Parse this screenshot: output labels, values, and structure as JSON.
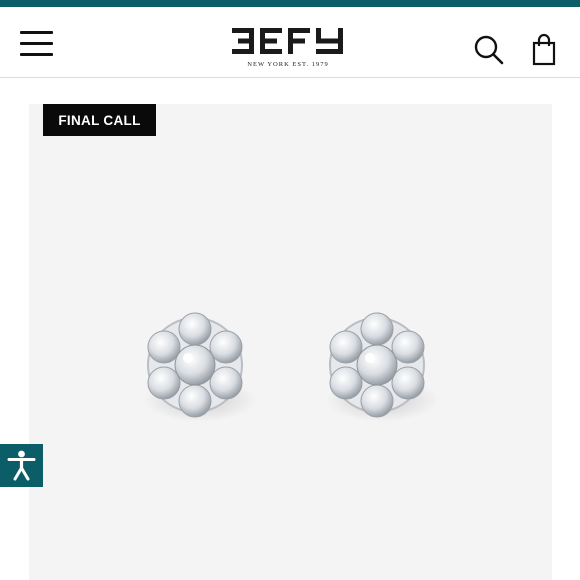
{
  "header": {
    "brand_tagline": "NEW YORK EST. 1979",
    "icons": {
      "menu": "hamburger-menu-icon",
      "search": "search-icon",
      "bag": "shopping-bag-icon"
    }
  },
  "product": {
    "badge": "FINAL CALL",
    "image": "diamond-cluster-stud-earrings"
  },
  "accessibility": {
    "icon": "accessibility-person-icon"
  },
  "colors": {
    "accent": "#0b5d67",
    "badge_bg": "#0a0a0a",
    "badge_text": "#ffffff",
    "stage_bg": "#f4f4f4"
  }
}
